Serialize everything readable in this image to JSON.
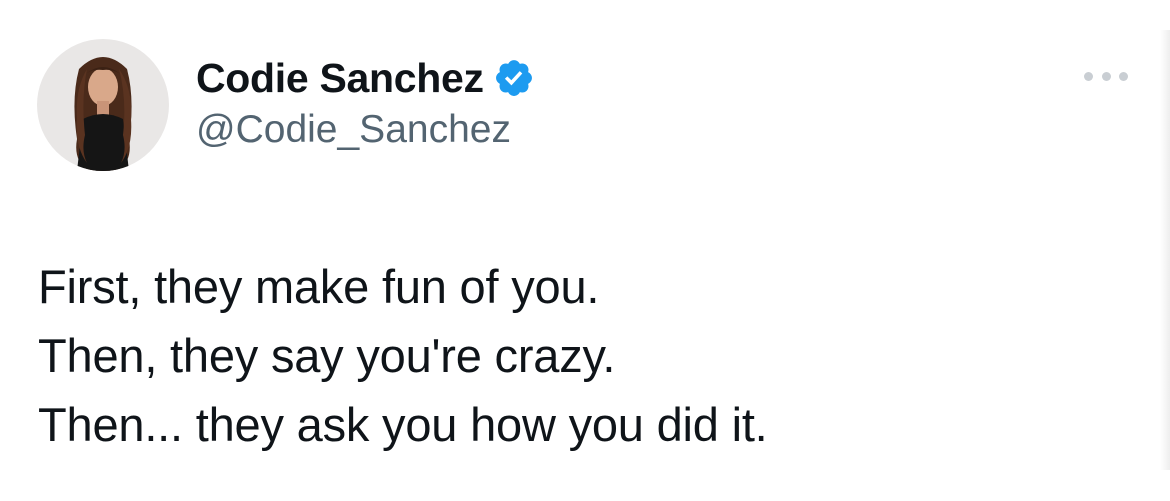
{
  "author": {
    "display_name": "Codie Sanchez",
    "handle": "@Codie_Sanchez",
    "verified": true
  },
  "tweet": {
    "lines": [
      "First, they make fun of you.",
      "Then, they say you're crazy.",
      "Then... they ask you how you did it."
    ]
  },
  "icons": {
    "verified": "verified-badge-icon",
    "more": "more-options-icon"
  },
  "colors": {
    "background": "#ffffff",
    "text_primary": "#0f1419",
    "text_secondary": "#536471",
    "verified_blue": "#1d9bf0",
    "more_dots": "#c9ced3"
  }
}
